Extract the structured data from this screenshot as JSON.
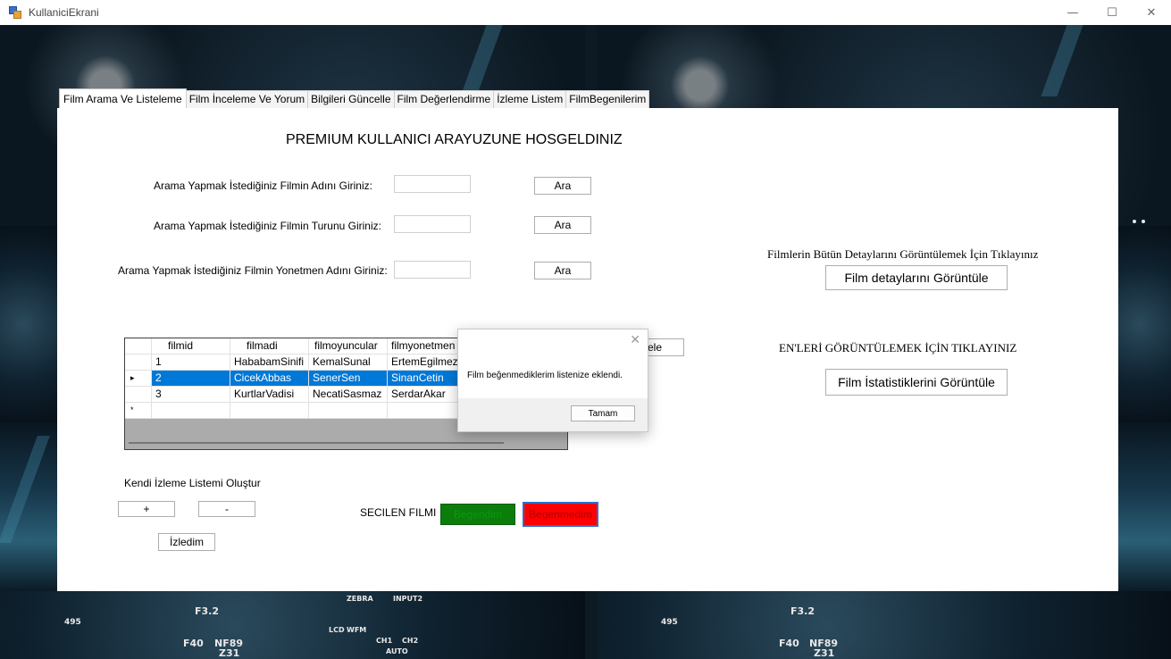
{
  "window": {
    "title": "KullaniciEkrani",
    "controls": {
      "minimize": "—",
      "maximize": "☐",
      "close": "✕"
    },
    "icon": "app-icon"
  },
  "tabs": [
    {
      "label": "Film Arama Ve Listeleme",
      "active": true
    },
    {
      "label": "Film İnceleme Ve Yorum",
      "active": false
    },
    {
      "label": "Bilgileri Güncelle",
      "active": false
    },
    {
      "label": "Film Değerlendirme",
      "active": false
    },
    {
      "label": "İzleme Listem",
      "active": false
    },
    {
      "label": "FilmBegenilerim",
      "active": false
    }
  ],
  "main": {
    "heading": "PREMIUM KULLANICI ARAYUZUNE HOSGELDINIZ",
    "search": {
      "name_label": "Arama Yapmak İstediğiniz Filmin Adını Giriniz:",
      "genre_label": "Arama Yapmak İstediğiniz Filmin Turunu Giriniz:",
      "director_label": "Arama Yapmak İstediğiniz Filmin Yonetmen Adını Giriniz:",
      "name_value": "",
      "genre_value": "",
      "director_value": "",
      "button_label": "Ara"
    },
    "hidden_button_fragment": "ele",
    "details_prompt": "Filmlerin Bütün Detaylarını Görüntülemek İçin Tıklayınız",
    "details_button": "Film detaylarını Görüntüle",
    "stats_prompt": "EN'LERİ GÖRÜNTÜLEMEK İÇİN TIKLAYINIZ",
    "stats_button": "Film İstatistiklerini Görüntüle",
    "watchlist": {
      "label": "Kendi İzleme Listemi Oluştur",
      "add_label": "+",
      "remove_label": "-",
      "watched_label": "İzledim"
    },
    "selected": {
      "label": "SECILEN FILMI",
      "like_label": "Begendim",
      "dislike_label": "Begenmedim",
      "like_color": "#0a7d0a",
      "dislike_color": "#ff0000"
    }
  },
  "grid": {
    "columns": [
      "filmid",
      "filmadi",
      "filmoyuncular",
      "filmyonetmen"
    ],
    "rows": [
      {
        "marker": "",
        "cells": [
          "1",
          "HababamSinifi",
          "KemalSunal",
          "ErtemEgilmez"
        ]
      },
      {
        "marker": "▸",
        "cells": [
          "2",
          "CicekAbbas",
          "SenerSen",
          "SinanCetin"
        ]
      },
      {
        "marker": "",
        "cells": [
          "3",
          "KurtlarVadisi",
          "NecatiSasmaz",
          "SerdarAkar"
        ]
      },
      {
        "marker": "*",
        "cells": [
          "",
          "",
          "",
          ""
        ]
      }
    ]
  },
  "dialog": {
    "message": "Film beğenmediklerim listenize eklendi.",
    "ok_label": "Tamam",
    "close_glyph": "✕"
  },
  "background": {
    "camera_labels": [
      "F40",
      "NF89",
      "Z31",
      "F3.2",
      "CH1",
      "CH2",
      "AUTO",
      "INPUT2",
      "LCD",
      "WFM",
      "ZEBRA",
      "495"
    ]
  }
}
